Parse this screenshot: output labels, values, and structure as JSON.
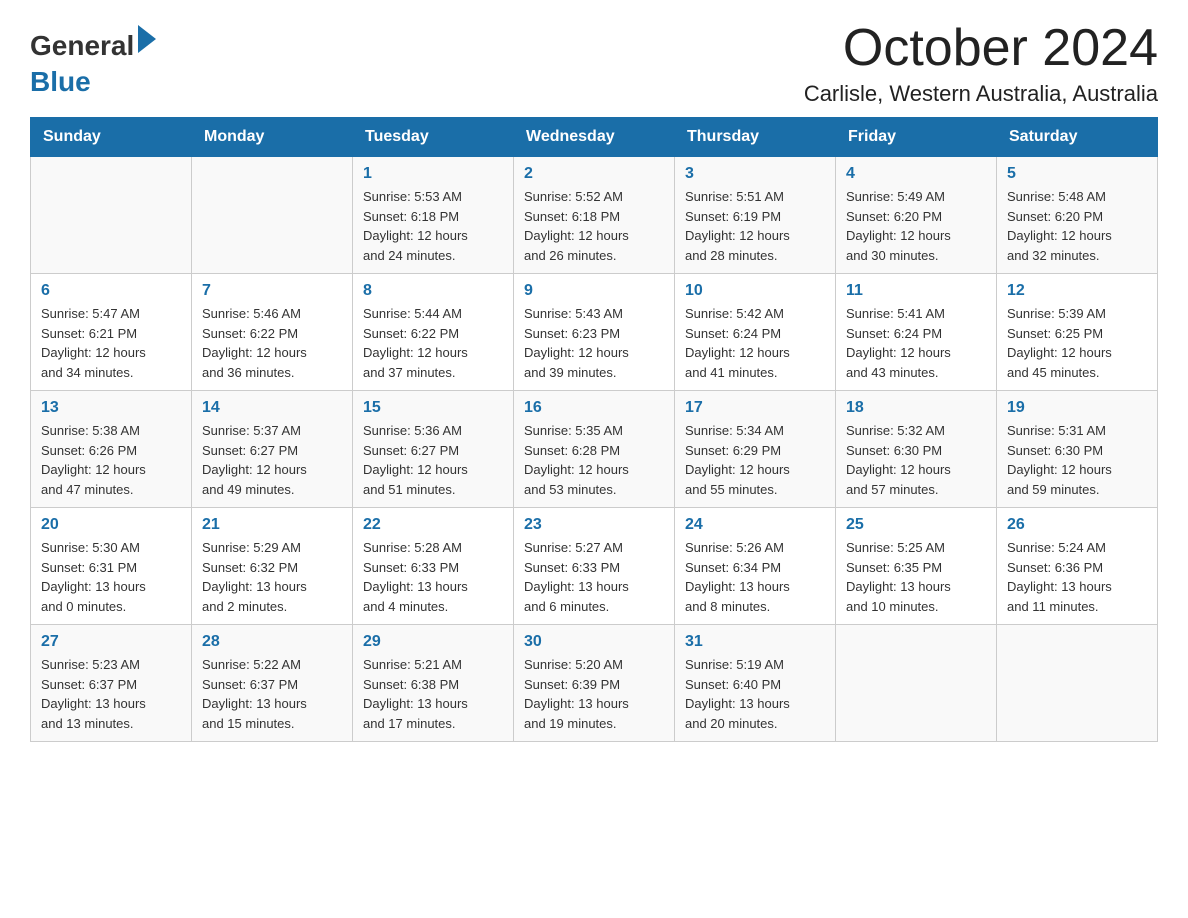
{
  "logo": {
    "general": "General",
    "blue": "Blue"
  },
  "header": {
    "month": "October 2024",
    "location": "Carlisle, Western Australia, Australia"
  },
  "weekdays": [
    "Sunday",
    "Monday",
    "Tuesday",
    "Wednesday",
    "Thursday",
    "Friday",
    "Saturday"
  ],
  "weeks": [
    [
      {
        "day": "",
        "info": ""
      },
      {
        "day": "",
        "info": ""
      },
      {
        "day": "1",
        "info": "Sunrise: 5:53 AM\nSunset: 6:18 PM\nDaylight: 12 hours\nand 24 minutes."
      },
      {
        "day": "2",
        "info": "Sunrise: 5:52 AM\nSunset: 6:18 PM\nDaylight: 12 hours\nand 26 minutes."
      },
      {
        "day": "3",
        "info": "Sunrise: 5:51 AM\nSunset: 6:19 PM\nDaylight: 12 hours\nand 28 minutes."
      },
      {
        "day": "4",
        "info": "Sunrise: 5:49 AM\nSunset: 6:20 PM\nDaylight: 12 hours\nand 30 minutes."
      },
      {
        "day": "5",
        "info": "Sunrise: 5:48 AM\nSunset: 6:20 PM\nDaylight: 12 hours\nand 32 minutes."
      }
    ],
    [
      {
        "day": "6",
        "info": "Sunrise: 5:47 AM\nSunset: 6:21 PM\nDaylight: 12 hours\nand 34 minutes."
      },
      {
        "day": "7",
        "info": "Sunrise: 5:46 AM\nSunset: 6:22 PM\nDaylight: 12 hours\nand 36 minutes."
      },
      {
        "day": "8",
        "info": "Sunrise: 5:44 AM\nSunset: 6:22 PM\nDaylight: 12 hours\nand 37 minutes."
      },
      {
        "day": "9",
        "info": "Sunrise: 5:43 AM\nSunset: 6:23 PM\nDaylight: 12 hours\nand 39 minutes."
      },
      {
        "day": "10",
        "info": "Sunrise: 5:42 AM\nSunset: 6:24 PM\nDaylight: 12 hours\nand 41 minutes."
      },
      {
        "day": "11",
        "info": "Sunrise: 5:41 AM\nSunset: 6:24 PM\nDaylight: 12 hours\nand 43 minutes."
      },
      {
        "day": "12",
        "info": "Sunrise: 5:39 AM\nSunset: 6:25 PM\nDaylight: 12 hours\nand 45 minutes."
      }
    ],
    [
      {
        "day": "13",
        "info": "Sunrise: 5:38 AM\nSunset: 6:26 PM\nDaylight: 12 hours\nand 47 minutes."
      },
      {
        "day": "14",
        "info": "Sunrise: 5:37 AM\nSunset: 6:27 PM\nDaylight: 12 hours\nand 49 minutes."
      },
      {
        "day": "15",
        "info": "Sunrise: 5:36 AM\nSunset: 6:27 PM\nDaylight: 12 hours\nand 51 minutes."
      },
      {
        "day": "16",
        "info": "Sunrise: 5:35 AM\nSunset: 6:28 PM\nDaylight: 12 hours\nand 53 minutes."
      },
      {
        "day": "17",
        "info": "Sunrise: 5:34 AM\nSunset: 6:29 PM\nDaylight: 12 hours\nand 55 minutes."
      },
      {
        "day": "18",
        "info": "Sunrise: 5:32 AM\nSunset: 6:30 PM\nDaylight: 12 hours\nand 57 minutes."
      },
      {
        "day": "19",
        "info": "Sunrise: 5:31 AM\nSunset: 6:30 PM\nDaylight: 12 hours\nand 59 minutes."
      }
    ],
    [
      {
        "day": "20",
        "info": "Sunrise: 5:30 AM\nSunset: 6:31 PM\nDaylight: 13 hours\nand 0 minutes."
      },
      {
        "day": "21",
        "info": "Sunrise: 5:29 AM\nSunset: 6:32 PM\nDaylight: 13 hours\nand 2 minutes."
      },
      {
        "day": "22",
        "info": "Sunrise: 5:28 AM\nSunset: 6:33 PM\nDaylight: 13 hours\nand 4 minutes."
      },
      {
        "day": "23",
        "info": "Sunrise: 5:27 AM\nSunset: 6:33 PM\nDaylight: 13 hours\nand 6 minutes."
      },
      {
        "day": "24",
        "info": "Sunrise: 5:26 AM\nSunset: 6:34 PM\nDaylight: 13 hours\nand 8 minutes."
      },
      {
        "day": "25",
        "info": "Sunrise: 5:25 AM\nSunset: 6:35 PM\nDaylight: 13 hours\nand 10 minutes."
      },
      {
        "day": "26",
        "info": "Sunrise: 5:24 AM\nSunset: 6:36 PM\nDaylight: 13 hours\nand 11 minutes."
      }
    ],
    [
      {
        "day": "27",
        "info": "Sunrise: 5:23 AM\nSunset: 6:37 PM\nDaylight: 13 hours\nand 13 minutes."
      },
      {
        "day": "28",
        "info": "Sunrise: 5:22 AM\nSunset: 6:37 PM\nDaylight: 13 hours\nand 15 minutes."
      },
      {
        "day": "29",
        "info": "Sunrise: 5:21 AM\nSunset: 6:38 PM\nDaylight: 13 hours\nand 17 minutes."
      },
      {
        "day": "30",
        "info": "Sunrise: 5:20 AM\nSunset: 6:39 PM\nDaylight: 13 hours\nand 19 minutes."
      },
      {
        "day": "31",
        "info": "Sunrise: 5:19 AM\nSunset: 6:40 PM\nDaylight: 13 hours\nand 20 minutes."
      },
      {
        "day": "",
        "info": ""
      },
      {
        "day": "",
        "info": ""
      }
    ]
  ]
}
